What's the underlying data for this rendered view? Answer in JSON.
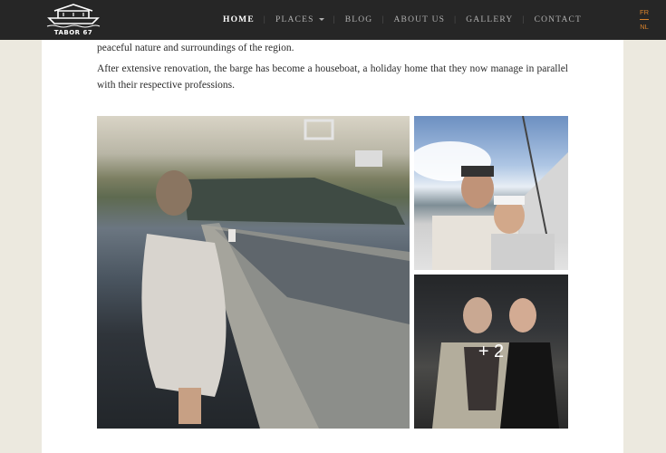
{
  "brand": {
    "logo_text": "TABOR 67"
  },
  "nav": {
    "items": [
      "HOME",
      "PLACES",
      "BLOG",
      "ABOUT US",
      "GALLERY",
      "CONTACT"
    ],
    "active": "HOME"
  },
  "lang": {
    "options": [
      "FR",
      "NL"
    ]
  },
  "content": {
    "paragraph_1": "peaceful nature and surroundings of the region.",
    "paragraph_2": "After extensive renovation, the barge has become a houseboat, a holiday home that they now manage in parallel with their respective professions."
  },
  "gallery": {
    "more_count": "+ 2"
  },
  "colors": {
    "nav_bg": "#262626",
    "accent": "#d8822c",
    "page_bg": "#ece9df"
  }
}
